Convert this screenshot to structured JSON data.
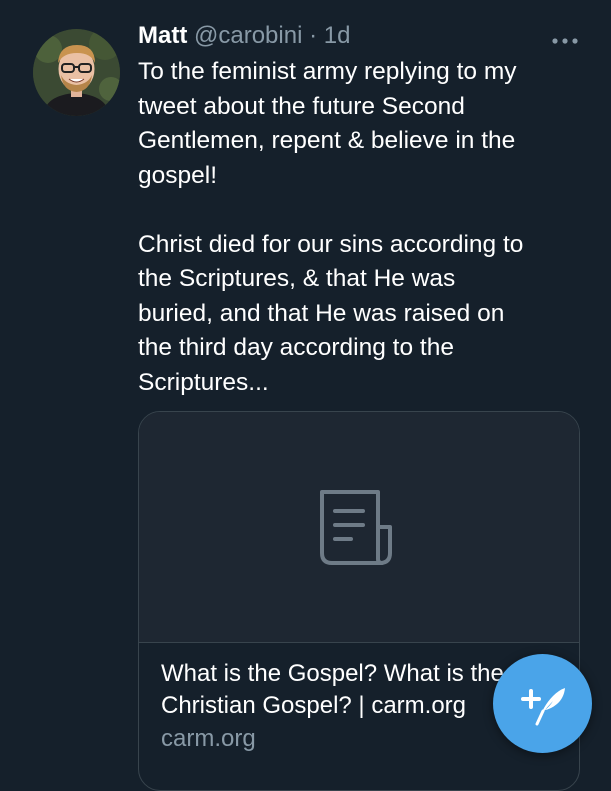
{
  "tweet": {
    "author": {
      "name": "Matt",
      "handle": "@carobini",
      "separator": "·",
      "time": "1d"
    },
    "more_icon": "more-horizontal-icon",
    "text": {
      "paragraph1": [
        "To the feminist army replying to my",
        "tweet about the future Second",
        "Gentlemen, repent & believe in the",
        "gospel!"
      ],
      "paragraph2": [
        "Christ died for our sins according to",
        "the Scriptures, & that He was",
        "buried, and that He was raised on",
        "the third day according to the",
        "Scriptures..."
      ]
    },
    "link_card": {
      "icon": "document-icon",
      "title_lines": [
        "What is the Gospel? What is the",
        "Christian Gospel? | carm.org"
      ],
      "domain": "carm.org"
    }
  },
  "compose_button": {
    "icon": "compose-tweet-icon",
    "color": "#4aa4e9"
  },
  "colors": {
    "background": "#15202b",
    "secondary_text": "#8899a6",
    "border": "#38444d",
    "accent": "#4aa4e9"
  }
}
